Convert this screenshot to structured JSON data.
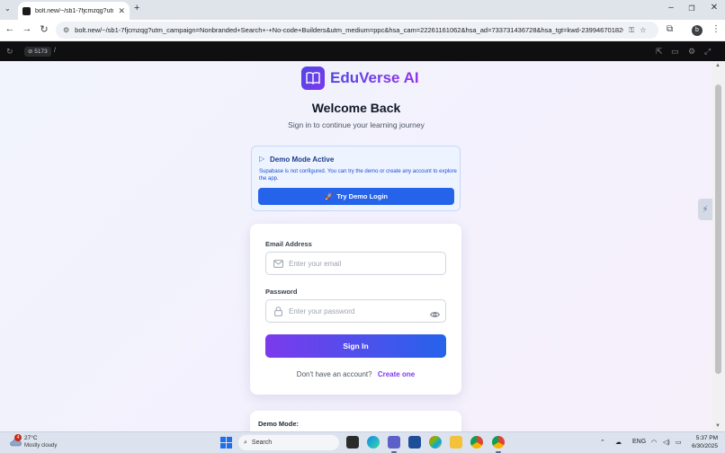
{
  "browser": {
    "tab_title": "bolt.new/~/sb1-7fjcmzqg?utm...",
    "url": "bolt.new/~/sb1-7fjcmzqg?utm_campaign=Nonbranded+Search+-+No-code+Builders&utm_medium=ppc&hsa_cam=22261161062&hsa_ad=733731436728&hsa_tgt=kwd-239946701820...",
    "profile_initial": "b"
  },
  "bolt": {
    "port": "5173",
    "path": "/"
  },
  "page": {
    "brand": "EduVerse AI",
    "heading": "Welcome Back",
    "subtitle": "Sign in to continue your learning journey",
    "demo_notice": {
      "title": "Demo Mode Active",
      "text": "Supabase is not configured. You can try the demo or create any account to explore the app.",
      "button": "Try Demo Login",
      "button_emoji": "🚀"
    },
    "form": {
      "email_label": "Email Address",
      "email_placeholder": "Enter your email",
      "password_label": "Password",
      "password_placeholder": "Enter your password",
      "submit": "Sign In",
      "no_account": "Don't have an account?",
      "create_link": "Create one"
    },
    "demo_card_title": "Demo Mode:"
  },
  "taskbar": {
    "weather_alerts": "4",
    "temperature": "27°C",
    "weather": "Mostly cloudy",
    "search_placeholder": "Search",
    "language": "ENG",
    "time": "5:37 PM",
    "date": "6/30/2025"
  },
  "colors": {
    "primary_blue": "#2563eb",
    "primary_purple": "#7c3aed",
    "brand_indigo": "#4f46e5"
  }
}
